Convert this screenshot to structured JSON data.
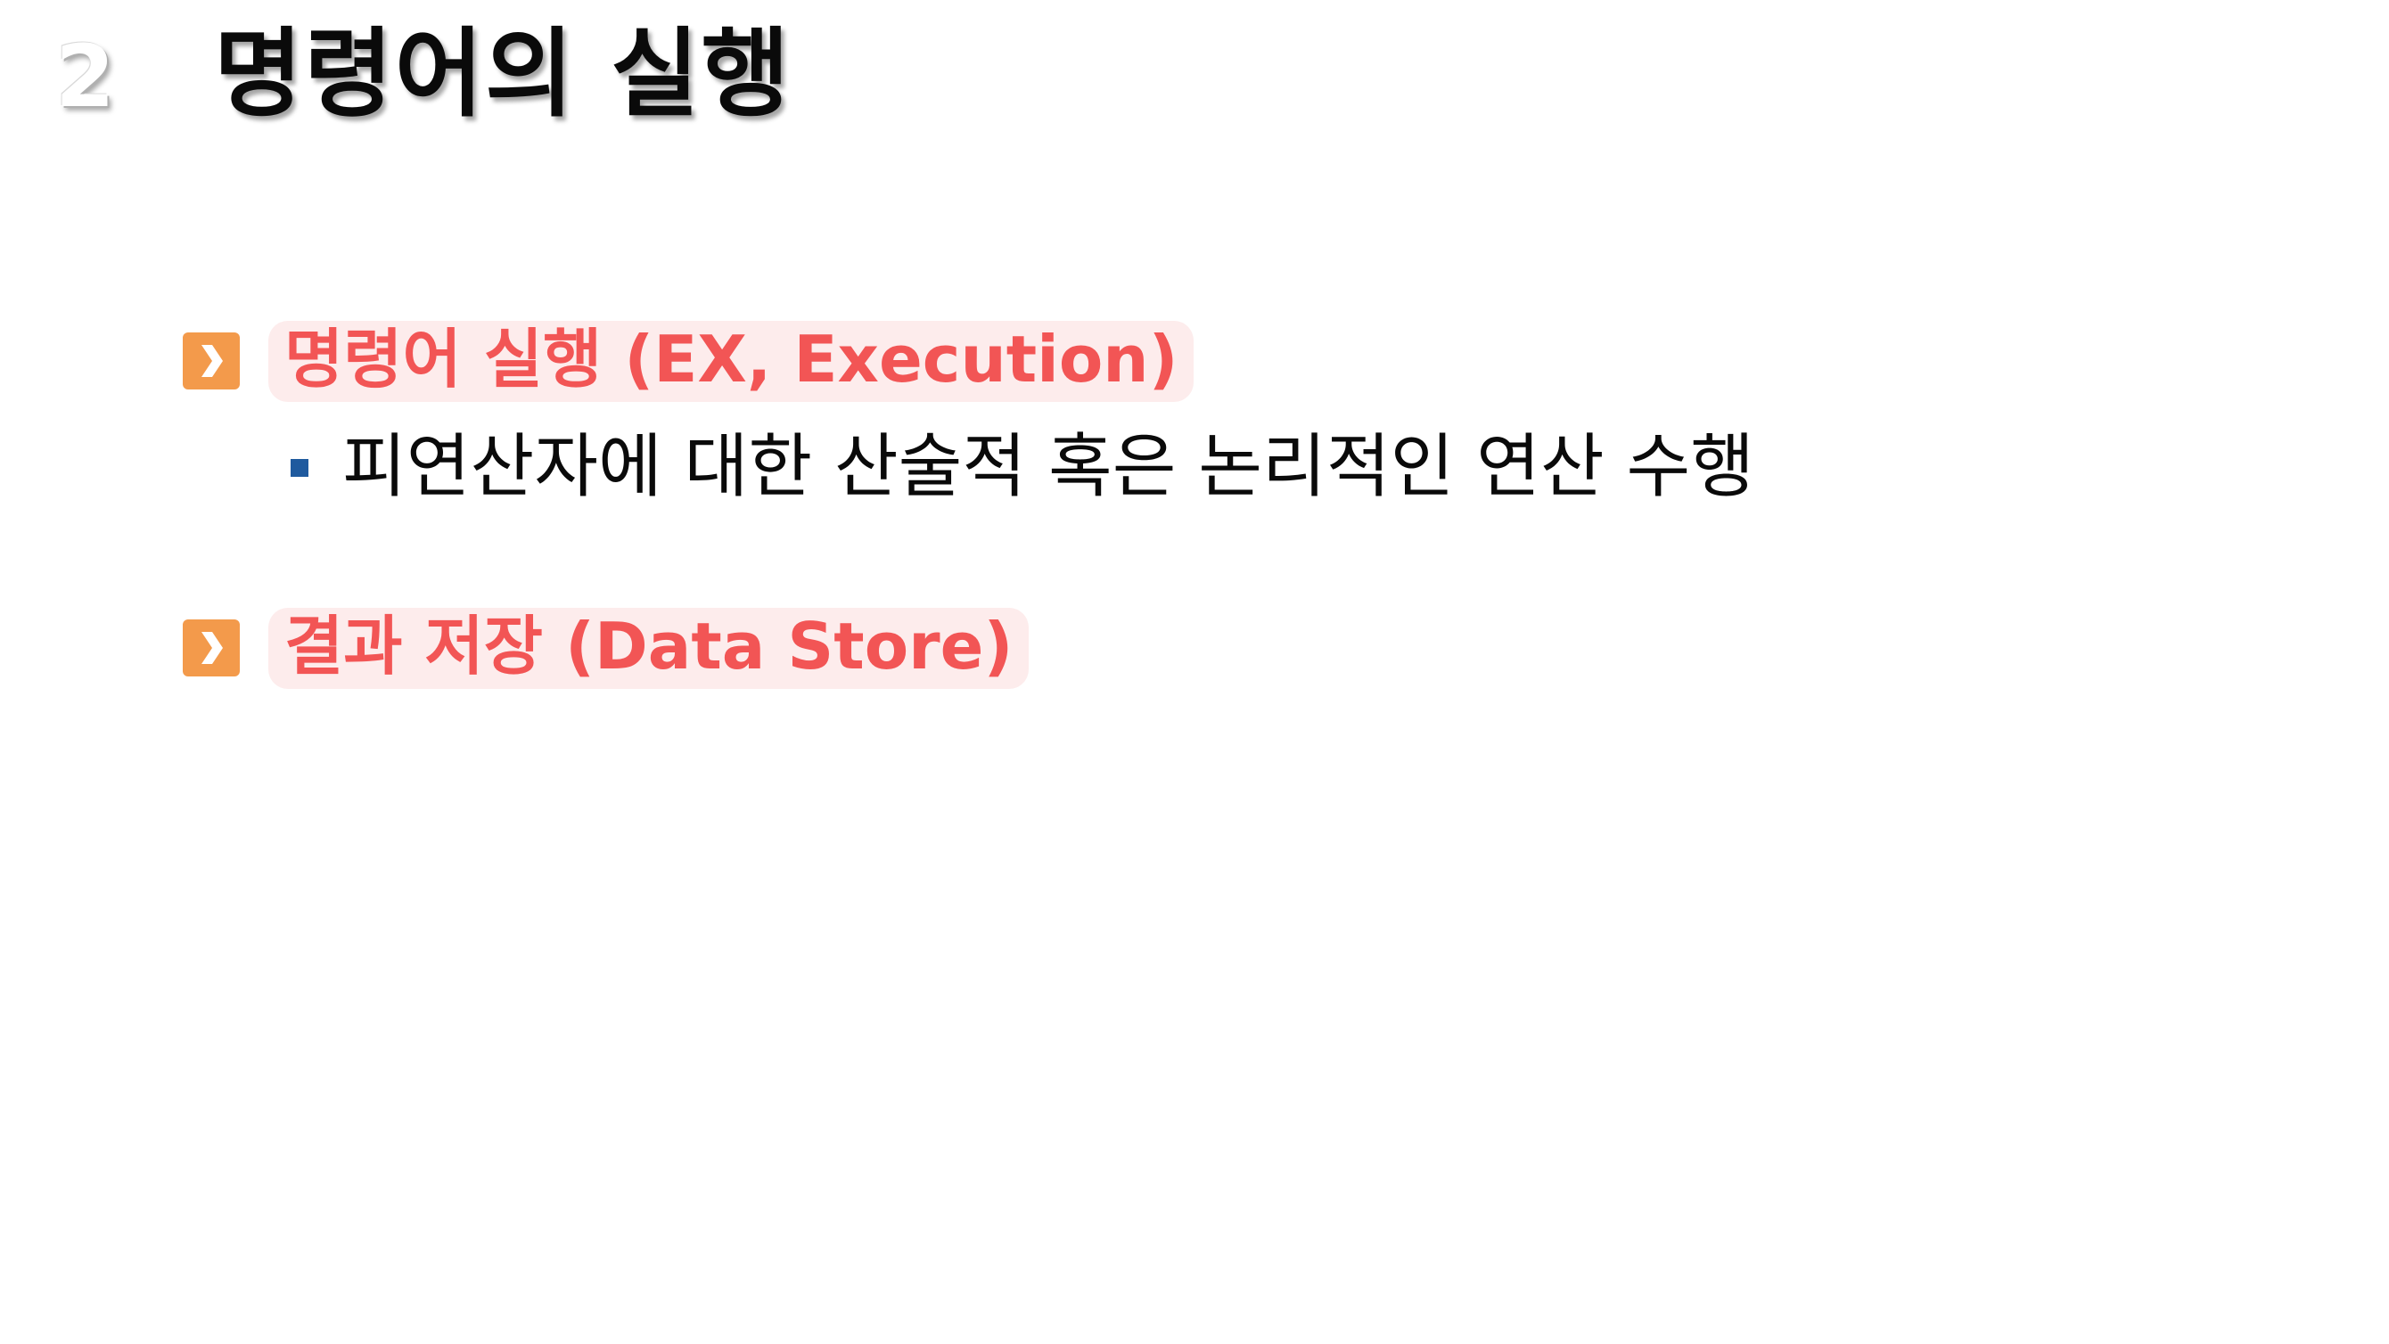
{
  "slide": {
    "number": "2",
    "title": "명령어의 실행"
  },
  "sections": [
    {
      "heading": "명령어 실행 (EX, Execution)",
      "bullets": [
        "피연산자에 대한 산술적 혹은 논리적인 연산 수행"
      ]
    },
    {
      "heading": "결과 저장 (Data Store)",
      "bullets": []
    }
  ],
  "icons": {
    "section_marker": "chevron-right-icon",
    "bullet_marker": "square-bullet-icon"
  },
  "colors": {
    "heading_text": "#f25555",
    "heading_background": "#fdecec",
    "marker_orange": "#f39a4b",
    "bullet_blue": "#1f5a9e"
  }
}
